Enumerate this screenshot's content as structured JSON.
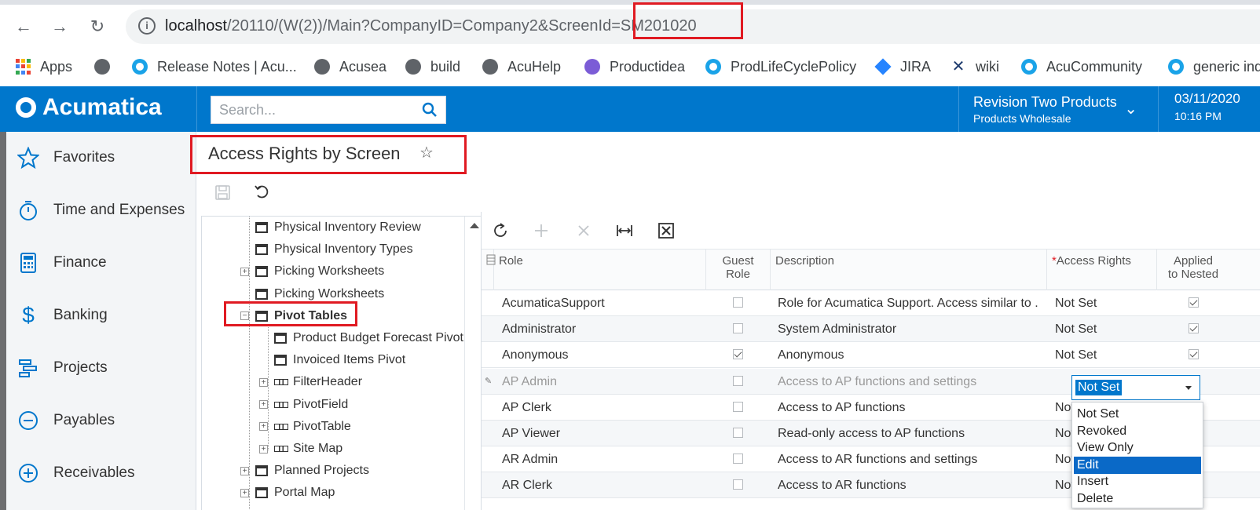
{
  "browser": {
    "url_host": "localhost",
    "url_path": "/20110/(W(2))/Main?CompanyID=Company2&ScreenId=SM201020",
    "bookmarks": [
      "Apps",
      "Release Notes | Acu...",
      "Acusea",
      "build",
      "AcuHelp",
      "Productidea",
      "ProdLifeCyclePolicy",
      "JIRA",
      "wiki",
      "AcuCommunity",
      "generic inq"
    ]
  },
  "header": {
    "logo_text": "Acumatica",
    "search_placeholder": "Search...",
    "branch_name": "Revision Two Products",
    "branch_sub": "Products Wholesale",
    "date": "03/11/2020",
    "time": "10:16 PM"
  },
  "sidebar": {
    "items": [
      {
        "label": "Favorites",
        "icon": "star-icon"
      },
      {
        "label": "Time and Expenses",
        "icon": "stopwatch-icon"
      },
      {
        "label": "Finance",
        "icon": "calculator-icon"
      },
      {
        "label": "Banking",
        "icon": "dollar-icon"
      },
      {
        "label": "Projects",
        "icon": "projects-icon"
      },
      {
        "label": "Payables",
        "icon": "minus-circle-icon"
      },
      {
        "label": "Receivables",
        "icon": "plus-circle-icon"
      }
    ]
  },
  "page": {
    "title": "Access Rights by Screen"
  },
  "tree": {
    "nodes": [
      {
        "label": "Physical Inventory Review",
        "type": "page",
        "expander": "",
        "level": 0
      },
      {
        "label": "Physical Inventory Types",
        "type": "page",
        "expander": "",
        "level": 0
      },
      {
        "label": "Picking Worksheets",
        "type": "page",
        "expander": "+",
        "level": 0
      },
      {
        "label": "Picking Worksheets",
        "type": "page",
        "expander": "",
        "level": 0
      },
      {
        "label": "Pivot Tables",
        "type": "page",
        "expander": "−",
        "level": 0,
        "bold": true
      },
      {
        "label": "Product Budget Forecast Pivot",
        "type": "page",
        "expander": "",
        "level": 1
      },
      {
        "label": "Invoiced Items Pivot",
        "type": "page",
        "expander": "",
        "level": 1
      },
      {
        "label": "FilterHeader",
        "type": "table",
        "expander": "+",
        "level": 1
      },
      {
        "label": "PivotField",
        "type": "table",
        "expander": "+",
        "level": 1
      },
      {
        "label": "PivotTable",
        "type": "table",
        "expander": "+",
        "level": 1
      },
      {
        "label": "Site Map",
        "type": "table",
        "expander": "+",
        "level": 1
      },
      {
        "label": "Planned Projects",
        "type": "page",
        "expander": "+",
        "level": 0
      },
      {
        "label": "Portal Map",
        "type": "page",
        "expander": "+",
        "level": 0
      }
    ]
  },
  "grid": {
    "columns": {
      "role": "Role",
      "guest_role_1": "Guest",
      "guest_role_2": "Role",
      "description": "Description",
      "required_mark": "*",
      "access_rights": "Access Rights",
      "applied_1": "Applied",
      "applied_2": "to Nested"
    },
    "rows": [
      {
        "role": "AcumaticaSupport",
        "guest": false,
        "description": "Role for Acumatica Support. Access similar to ...",
        "rights": "Not Set",
        "nested": true
      },
      {
        "role": "Administrator",
        "guest": false,
        "description": "System Administrator",
        "rights": "Not Set",
        "nested": true
      },
      {
        "role": "Anonymous",
        "guest": true,
        "description": "Anonymous",
        "rights": "Not Set",
        "nested": true
      },
      {
        "role": "AP Admin",
        "guest": false,
        "description": "Access to AP functions and settings",
        "rights": "Not Set",
        "nested": true
      },
      {
        "role": "AP Clerk",
        "guest": false,
        "description": "Access to AP functions",
        "rights": "Not Set",
        "nested": true
      },
      {
        "role": "AP Viewer",
        "guest": false,
        "description": "Read-only access to AP functions",
        "rights": "Not Set",
        "nested": true
      },
      {
        "role": "AR Admin",
        "guest": false,
        "description": "Access to AR functions and settings",
        "rights": "Not Set",
        "nested": true
      },
      {
        "role": "AR Clerk",
        "guest": false,
        "description": "Access to AR functions",
        "rights": "Not Set",
        "nested": true
      }
    ],
    "editor_value": "Not Set",
    "options": [
      "Not Set",
      "Revoked",
      "View Only",
      "Edit",
      "Insert",
      "Delete"
    ],
    "highlighted_option": "Edit"
  }
}
